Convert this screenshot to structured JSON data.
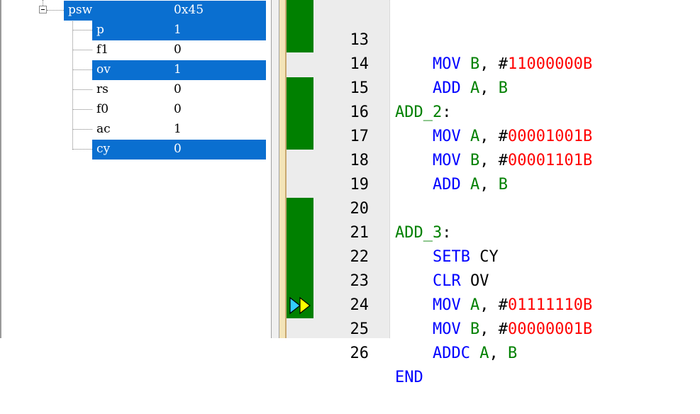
{
  "registers": {
    "parent": {
      "name": "psw",
      "value": "0x45"
    },
    "children": [
      {
        "name": "p",
        "value": "1"
      },
      {
        "name": "f1",
        "value": "0"
      },
      {
        "name": "ov",
        "value": "1"
      },
      {
        "name": "rs",
        "value": "0"
      },
      {
        "name": "f0",
        "value": "0"
      },
      {
        "name": "ac",
        "value": "1"
      },
      {
        "name": "cy",
        "value": "0"
      }
    ]
  },
  "code": {
    "lines": [
      {
        "num": "13",
        "instr": "MOV",
        "op1": "B",
        "sep": ", #",
        "imm": "11000000B"
      },
      {
        "num": "14",
        "instr": "ADD",
        "op1": "A",
        "sep": ", ",
        "op2": "B"
      },
      {
        "num": "15",
        "label": "ADD_2",
        "colon": ":"
      },
      {
        "num": "16",
        "instr": "MOV",
        "op1": "A",
        "sep": ", #",
        "imm": "00001001B"
      },
      {
        "num": "17",
        "instr": "MOV",
        "op1": "B",
        "sep": ", #",
        "imm": "00001101B"
      },
      {
        "num": "18",
        "instr": "ADD",
        "op1": "A",
        "sep": ", ",
        "op2": "B"
      },
      {
        "num": "19"
      },
      {
        "num": "20",
        "label": "ADD_3",
        "colon": ":"
      },
      {
        "num": "21",
        "instr": "SETB",
        "op1": "CY"
      },
      {
        "num": "22",
        "instr": "CLR",
        "op1": "OV"
      },
      {
        "num": "23",
        "instr": "MOV",
        "op1": "A",
        "sep": ", #",
        "imm": "01111110B"
      },
      {
        "num": "24",
        "instr": "MOV",
        "op1": "B",
        "sep": ", #",
        "imm": "00000001B"
      },
      {
        "num": "25",
        "instr": "ADDC",
        "op1": "A",
        "sep": ", ",
        "op2": "B"
      },
      {
        "num": "26",
        "instr": "END"
      }
    ]
  },
  "colors": {
    "selection": "#0a6fd0",
    "coverage": "#008000",
    "keyword": "#0000ff",
    "label": "#008000",
    "immediate": "#ff0000",
    "current_arrow": "#ffff00",
    "breakpoint_arrow": "#33ccff"
  }
}
